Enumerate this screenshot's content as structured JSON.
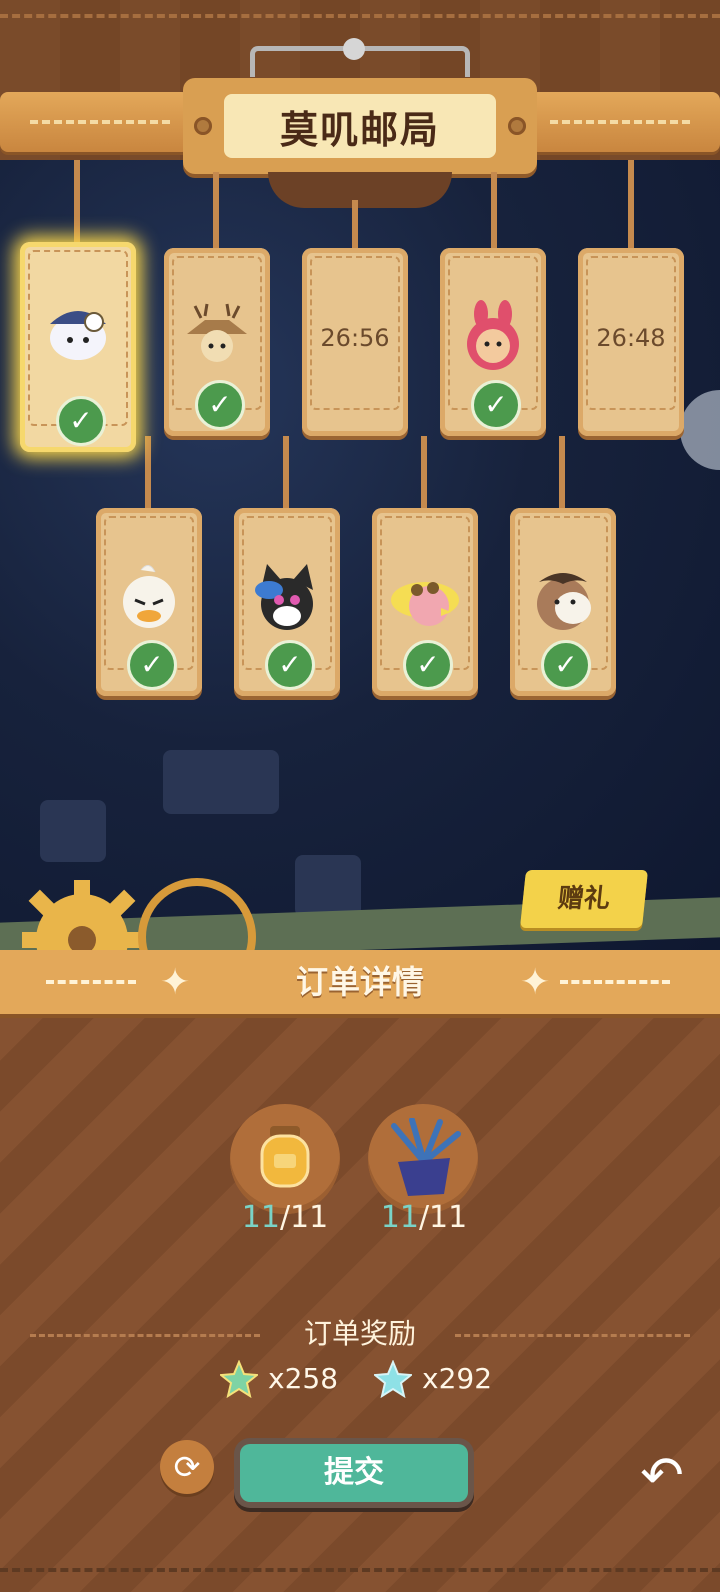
{
  "header": {
    "title": "莫叽邮局"
  },
  "cards": [
    {
      "id": "c1",
      "status": "done",
      "selected": true,
      "icon": "owl-icon"
    },
    {
      "id": "c2",
      "status": "done",
      "selected": false,
      "icon": "scarecrow-icon"
    },
    {
      "id": "c3",
      "status": "timer",
      "timer": "26:56",
      "icon": ""
    },
    {
      "id": "c4",
      "status": "done",
      "selected": false,
      "icon": "pink-rabbit-icon"
    },
    {
      "id": "c5",
      "status": "timer",
      "timer": "26:48",
      "icon": ""
    },
    {
      "id": "c6",
      "status": "done",
      "selected": false,
      "icon": "duck-icon"
    },
    {
      "id": "c7",
      "status": "done",
      "selected": false,
      "icon": "cat-icon"
    },
    {
      "id": "c8",
      "status": "done",
      "selected": false,
      "icon": "chick-icon"
    },
    {
      "id": "c9",
      "status": "done",
      "selected": false,
      "icon": "cow-icon"
    }
  ],
  "gift_button": {
    "label": "赠礼"
  },
  "order": {
    "title": "订单详情",
    "items": [
      {
        "name": "honey-jar-icon",
        "have": "11",
        "need": "/11"
      },
      {
        "name": "plant-pot-icon",
        "have": "11",
        "need": "/11"
      }
    ],
    "reward_label": "订单奖励",
    "rewards": [
      {
        "icon": "green-star-icon",
        "amount": "x258"
      },
      {
        "icon": "blue-star-icon",
        "amount": "x292"
      }
    ]
  },
  "actions": {
    "submit": "提交",
    "refresh_icon": "refresh-icon",
    "back_icon": "back-arrow-icon"
  }
}
